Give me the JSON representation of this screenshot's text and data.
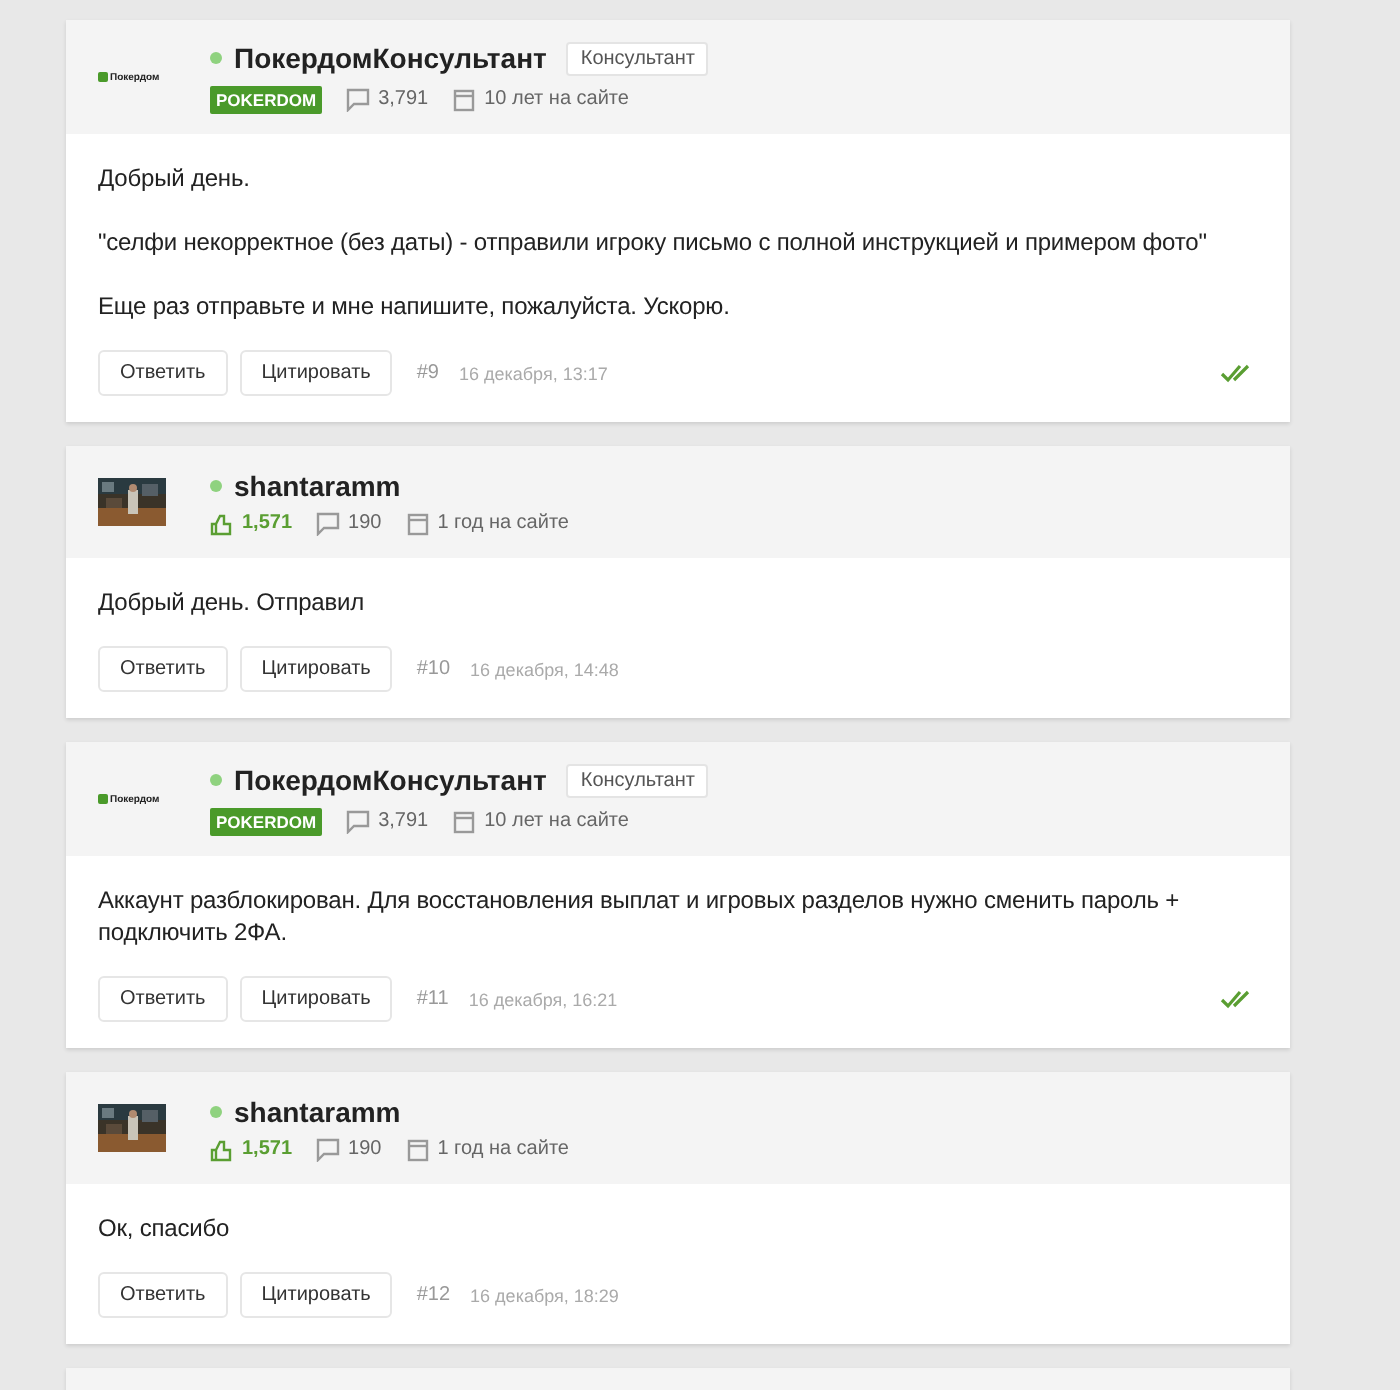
{
  "posts": [
    {
      "author": {
        "name": "ПокердомКонсультант",
        "online": true,
        "avatar": {
          "kind": "logo",
          "text": "Покердом"
        },
        "title": "Консультант",
        "group_badge": "POKERDOM",
        "stats": [
          {
            "kind": "messages",
            "text": "3,791"
          },
          {
            "kind": "joined",
            "text": "10 лет на сайте"
          }
        ]
      },
      "paragraphs": [
        "Добрый день.",
        "\"селфи некорректное (без даты) - отправили игроку письмо с полной инструкцией и примером фото\"",
        "Еще раз отправьте и мне напишите, пожалуйста. Ускорю."
      ],
      "buttons": [
        "Ответить",
        "Цитировать"
      ],
      "number": "#9",
      "date": "16 декабря, 13:17",
      "read": true
    },
    {
      "author": {
        "name": "shantaramm",
        "online": true,
        "stats": [
          {
            "kind": "likes",
            "text": "1,571"
          },
          {
            "kind": "messages",
            "text": "190"
          },
          {
            "kind": "joined",
            "text": "1 год на сайте"
          }
        ]
      },
      "paragraphs": [
        "Добрый день. Отправил"
      ],
      "buttons": [
        "Ответить",
        "Цитировать"
      ],
      "number": "#10",
      "date": "16 декабря, 14:48",
      "read": false
    },
    {
      "author": {
        "name": "ПокердомКонсультант",
        "online": true,
        "avatar": {
          "kind": "logo",
          "text": "Покердом"
        },
        "title": "Консультант",
        "group_badge": "POKERDOM",
        "stats": [
          {
            "kind": "messages",
            "text": "3,791"
          },
          {
            "kind": "joined",
            "text": "10 лет на сайте"
          }
        ]
      },
      "paragraphs": [
        "Аккаунт разблокирован. Для восстановления выплат и игровых разделов нужно сменить пароль + подключить 2ФА."
      ],
      "buttons": [
        "Ответить",
        "Цитировать"
      ],
      "number": "#11",
      "date": "16 декабря, 16:21",
      "read": true
    },
    {
      "author": {
        "name": "shantaramm",
        "online": true,
        "stats": [
          {
            "kind": "likes",
            "text": "1,571"
          },
          {
            "kind": "messages",
            "text": "190"
          },
          {
            "kind": "joined",
            "text": "1 год на сайте"
          }
        ]
      },
      "paragraphs": [
        "Ок, спасибо"
      ],
      "buttons": [
        "Ответить",
        "Цитировать"
      ],
      "number": "#12",
      "date": "16 декабря, 18:29",
      "read": false
    }
  ]
}
